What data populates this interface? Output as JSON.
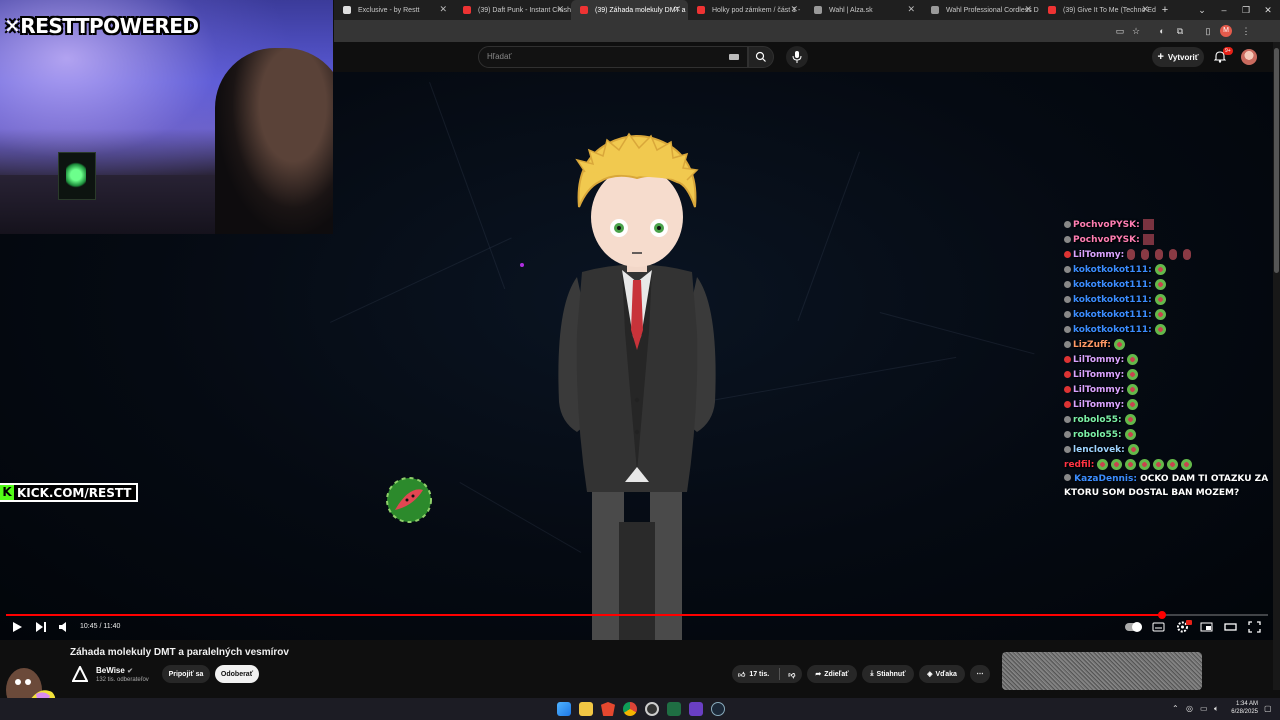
{
  "browser": {
    "tabs": [
      {
        "label": "Exclusive - by Restt",
        "active": false
      },
      {
        "label": "(39) Daft Punk - Instant Crush",
        "active": false
      },
      {
        "label": "(39) Záhada molekuly DMT a",
        "active": true
      },
      {
        "label": "Holky pod zámkem / část 1 -",
        "active": false
      },
      {
        "label": "Wahl | Alza.sk",
        "active": false
      },
      {
        "label": "Wahl Professional Cordless D",
        "active": false
      },
      {
        "label": "(39) Give It To Me (Techno Ed",
        "active": false
      }
    ]
  },
  "youtube": {
    "search_placeholder": "Hľadať",
    "create_label": "Vytvoriť",
    "notification_count": "9+"
  },
  "stream_overlay": {
    "brand": "RESTTPOWERED",
    "kick": "KICK.COM/RESTT",
    "chat": [
      {
        "user": "PochvoPYSK:",
        "color": "#ff7eb3",
        "emote": "brick",
        "dot": "grey"
      },
      {
        "user": "PochvoPYSK:",
        "color": "#ff7eb3",
        "emote": "brick",
        "dot": "grey"
      },
      {
        "user": "LilTommy:",
        "color": "#d9a3ff",
        "emote": "hands",
        "dot": "red"
      },
      {
        "user": "kokotkokot111:",
        "color": "#3b8dff",
        "emote": "melon",
        "dot": "grey"
      },
      {
        "user": "kokotkokot111:",
        "color": "#3b8dff",
        "emote": "melon",
        "dot": "grey"
      },
      {
        "user": "kokotkokot111:",
        "color": "#3b8dff",
        "emote": "melon",
        "dot": "grey"
      },
      {
        "user": "kokotkokot111:",
        "color": "#3b8dff",
        "emote": "melon",
        "dot": "grey"
      },
      {
        "user": "kokotkokot111:",
        "color": "#3b8dff",
        "emote": "melon",
        "dot": "grey"
      },
      {
        "user": "LizZuff:",
        "color": "#ff9966",
        "emote": "melon",
        "dot": "grey"
      },
      {
        "user": "LilTommy:",
        "color": "#d9a3ff",
        "emote": "melon",
        "dot": "red"
      },
      {
        "user": "LilTommy:",
        "color": "#d9a3ff",
        "emote": "melon",
        "dot": "red"
      },
      {
        "user": "LilTommy:",
        "color": "#d9a3ff",
        "emote": "melon",
        "dot": "red"
      },
      {
        "user": "LilTommy:",
        "color": "#d9a3ff",
        "emote": "melon",
        "dot": "red"
      },
      {
        "user": "robolo55:",
        "color": "#7cf2a8",
        "emote": "melon",
        "dot": "grey"
      },
      {
        "user": "robolo55:",
        "color": "#7cf2a8",
        "emote": "melon",
        "dot": "grey"
      },
      {
        "user": "lenclovek:",
        "color": "#9dd3ff",
        "emote": "melon",
        "dot": "grey"
      },
      {
        "user": "redfil:",
        "color": "#ff3344",
        "emote": "melons",
        "dot": "none"
      }
    ],
    "last_user": "KazaDennis:",
    "last_user_color": "#3b8dff",
    "last_message": "OCKO DAM TI OTAZKU ZA KTORU SOM DOSTAL BAN MOZEM?"
  },
  "player": {
    "time": "10:45 / 11:40",
    "progress": 0.916
  },
  "video": {
    "title": "Záhada molekuly DMT a paralelných vesmírov",
    "channel": "BeWise",
    "subscribers": "132 tis. odberateľov",
    "join_label": "Pripojiť sa",
    "subscribe_label": "Odoberať",
    "likes": "17 tis.",
    "share_label": "Zdieľať",
    "download_label": "Stiahnuť",
    "thanks_label": "Vďaka"
  },
  "taskbar": {
    "time": "1:34 AM",
    "date": "6/28/2025"
  },
  "colors": {
    "progress": "#ff0000",
    "kick_green": "#53fc18"
  }
}
